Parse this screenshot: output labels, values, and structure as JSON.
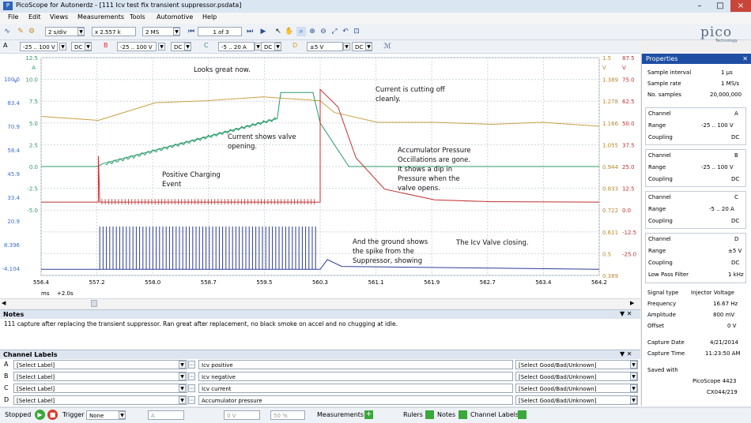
{
  "window": {
    "title": "PicoScope for Autonerdz - [111 Icv test fix transient suppressor.psdata]",
    "controls": [
      "–",
      "□",
      "×"
    ]
  },
  "menu": [
    "File",
    "Edit",
    "Views",
    "Measurements",
    "Tools",
    "Automotive",
    "Help"
  ],
  "toolbar": {
    "timebase": "2 s/div",
    "zoom": "x 2.557 k",
    "samples": "2 MS",
    "buffer": "1 of 3",
    "logo": "pico",
    "logo_sub": "Technology"
  },
  "channels_bar": [
    {
      "id": "A",
      "range": "-25 .. 100 V",
      "coupling": "DC",
      "color": "#3a6fd0"
    },
    {
      "id": "B",
      "range": "-25 .. 100 V",
      "coupling": "DC",
      "color": "#d03030"
    },
    {
      "id": "C",
      "range": "-5 .. 20 A",
      "coupling": "DC",
      "color": "#2a9a6a"
    },
    {
      "id": "D",
      "range": "±5 V",
      "coupling": "DC",
      "color": "#d0a020"
    }
  ],
  "chart_data": {
    "type": "line",
    "title": "",
    "x_ticks": [
      "556.4",
      "557.2",
      "558.0",
      "558.7",
      "559.5",
      "560.3",
      "561.1",
      "561.9",
      "562.7",
      "563.4",
      "564.2"
    ],
    "x_unit": "ms",
    "x_offset": "+2.0s",
    "axis_a_ticks": [
      "12.5",
      "10.0",
      "7.5",
      "5.0",
      "2.5",
      "0.0",
      "-2.5",
      "-5.0"
    ],
    "axis_a_unit": "A",
    "axis_v_unit": "V",
    "axis_v_ticks": [
      "100.0",
      "83.4",
      "70.9",
      "58.4",
      "45.9",
      "33.4",
      "20.9",
      "8.396",
      "-4.104"
    ],
    "axis_d_ticks": [
      "1.5",
      "1.389",
      "1.278",
      "1.166",
      "1.055",
      "0.944",
      "0.833",
      "0.722",
      "0.611",
      "0.5",
      "0.389"
    ],
    "axis_d_unit": "V",
    "axis_c_ticks": [
      "87.5",
      "75.0",
      "62.5",
      "50.0",
      "37.5",
      "25.0",
      "12.5",
      "0.0",
      "-12.5",
      "-25.0"
    ],
    "axis_c_unit": "V",
    "series": [
      {
        "color": "#c8a040",
        "x": [
          556.4,
          557.2,
          558.0,
          558.7,
          559.5,
          560.3,
          560.5,
          561.1,
          561.9,
          562.7,
          563.4,
          564.2
        ],
        "values": [
          1.2,
          1.18,
          1.27,
          1.28,
          1.3,
          1.28,
          1.22,
          1.17,
          1.17,
          1.16,
          1.17,
          1.15
        ]
      },
      {
        "color": "#2a9a6a",
        "x": [
          556.4,
          557.2,
          557.25,
          559.7,
          559.75,
          560.2,
          560.3,
          560.7,
          564.2
        ],
        "values": [
          0.0,
          0.0,
          0.3,
          5.5,
          8.5,
          8.5,
          5.0,
          0.0,
          0.0
        ]
      },
      {
        "color": "#c03030",
        "x": [
          556.4,
          557.2,
          557.2,
          557.22,
          560.3,
          560.3,
          560.55,
          560.8,
          561.2,
          561.9,
          562.7,
          564.2
        ],
        "values": [
          33.4,
          33.4,
          57.0,
          33.4,
          33.4,
          91.0,
          82.0,
          56.0,
          40.0,
          34.5,
          33.6,
          33.4
        ]
      },
      {
        "color": "#2a3c9a",
        "x": [
          556.4,
          557.2,
          560.3,
          560.4,
          560.6,
          564.2
        ],
        "values": [
          -1.0,
          -1.0,
          -1.0,
          4.0,
          0.5,
          -1.0
        ]
      }
    ],
    "annotations": [
      "Looks great now.",
      "Current is cutting off\ncleanly.",
      "Current shows valve\nopening.",
      "Accumulator Pressure\nOccillations are gone.\nIt shows a dip in\nPressure when the\nvalve opens.",
      "Positive Charging\nEvent",
      "And the ground shows\nthe spike from the\nSuppressor, showing",
      "The Icv Valve closing."
    ]
  },
  "properties": {
    "title": "Properties",
    "rows": [
      [
        "Sample interval",
        "1 µs"
      ],
      [
        "Sample rate",
        "1 MS/s"
      ],
      [
        "No. samples",
        "20,000,000"
      ]
    ],
    "channels": [
      {
        "channel": "A",
        "range": "-25 .. 100 V",
        "coupling": "DC"
      },
      {
        "channel": "B",
        "range": "-25 .. 100 V",
        "coupling": "DC"
      },
      {
        "channel": "C",
        "range": "-5 .. 20 A",
        "coupling": "DC"
      },
      {
        "channel": "D",
        "range": "±5 V",
        "coupling": "DC",
        "low_pass": "1 kHz"
      }
    ],
    "labels": {
      "channel": "Channel",
      "range": "Range",
      "coupling": "Coupling",
      "low_pass": "Low Pass Filter"
    },
    "signal": [
      [
        "Signal type",
        "Injector Voltage"
      ],
      [
        "Frequency",
        "16.67 Hz"
      ],
      [
        "Amplitude",
        "800 mV"
      ],
      [
        "Offset",
        "0 V"
      ]
    ],
    "capture": [
      [
        "Capture Date",
        "4/21/2014"
      ],
      [
        "Capture Time",
        "11:23:50 AM"
      ]
    ],
    "saved_with_label": "Saved with",
    "saved_with": [
      "PicoScope 4423",
      "CX044/219"
    ]
  },
  "notes": {
    "title": "Notes",
    "text": "111 capture after replacing the transient suppressor.  Ran great after replacement, no black smoke on accel and no chugging at idle."
  },
  "channel_labels": {
    "title": "Channel Labels",
    "rows": [
      {
        "ch": "A",
        "label": "[Select Label]",
        "desc": "Icv positive",
        "good": "[Select Good/Bad/Unknown]"
      },
      {
        "ch": "B",
        "label": "[Select Label]",
        "desc": "Icv negative",
        "good": "[Select Good/Bad/Unknown]"
      },
      {
        "ch": "C",
        "label": "[Select Label]",
        "desc": "Icv current",
        "good": "[Select Good/Bad/Unknown]"
      },
      {
        "ch": "D",
        "label": "[Select Label]",
        "desc": "Accumulator pressure",
        "good": "[Select Good/Bad/Unknown]"
      }
    ]
  },
  "status": {
    "state": "Stopped",
    "trigger_label": "Trigger",
    "trigger_value": "None",
    "trigger_channel": "A",
    "level": "0 V",
    "percent": "50 %",
    "measurements": "Measurements",
    "rulers": "Rulers",
    "notes": "Notes",
    "channel_labels": "Channel Labels"
  }
}
